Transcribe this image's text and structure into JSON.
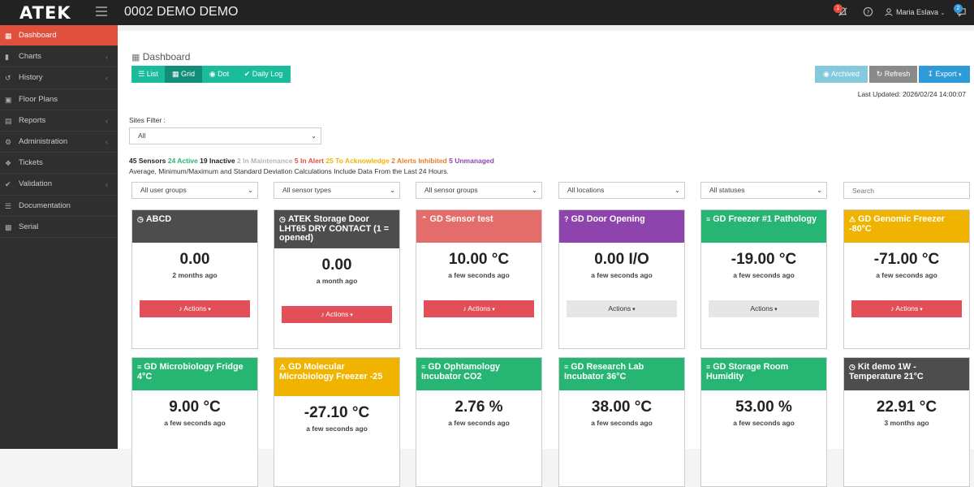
{
  "header": {
    "logo": "ATEK",
    "title": "0002 DEMO DEMO",
    "notif_count": "1",
    "user_name": "Maria Eslava",
    "user_badge": "2"
  },
  "sidebar": {
    "items": [
      {
        "label": "Dashboard",
        "icon": "dashboard-icon",
        "active": true
      },
      {
        "label": "Charts",
        "icon": "chart-icon",
        "expandable": true
      },
      {
        "label": "History",
        "icon": "history-icon",
        "expandable": true
      },
      {
        "label": "Floor Plans",
        "icon": "floorplan-icon"
      },
      {
        "label": "Reports",
        "icon": "reports-icon",
        "expandable": true
      },
      {
        "label": "Administration",
        "icon": "admin-icon",
        "expandable": true
      },
      {
        "label": "Tickets",
        "icon": "tag-icon"
      },
      {
        "label": "Validation",
        "icon": "check-circle-icon",
        "expandable": true
      },
      {
        "label": "Documentation",
        "icon": "book-icon"
      },
      {
        "label": "Serial",
        "icon": "serial-icon"
      }
    ]
  },
  "main": {
    "title": "Dashboard",
    "view_buttons": {
      "list": "List",
      "grid": "Grid",
      "dot": "Dot",
      "daily_log": "Daily Log"
    },
    "archived": "Archived",
    "refresh": "Refresh",
    "export": "Export",
    "last_updated": "Last Updated: 2026/02/24 14:00:07",
    "sites_filter_label": "Sites Filter :",
    "sites_filter_value": "All",
    "stats": {
      "sensors": "45 Sensors",
      "active": "24 Active",
      "inactive": "19 Inactive",
      "maintenance": "2 In Maintenance",
      "alert": "5 In Alert",
      "acknowledge": "25 To Acknowledge",
      "inhibited": "2 Alerts Inhibited",
      "unmanaged": "5 Unmanaged"
    },
    "note": "Average, Minimum/Maximum and Standard Deviation Calculations Include Data From the Last 24 Hours.",
    "filters": {
      "user_groups": "All user groups",
      "sensor_types": "All sensor types",
      "sensor_groups": "All sensor groups",
      "locations": "All locations",
      "statuses": "All statuses",
      "search_placeholder": "Search"
    },
    "actions_label": "Actions",
    "cards": [
      {
        "title": "ABCD",
        "icon": "clock-icon",
        "value": "0.00",
        "time": "2 months ago",
        "color": "#4d4d4d",
        "action_color": "#e34f58"
      },
      {
        "title": "ATEK Storage Door LHT65 DRY CONTACT (1 = opened)",
        "icon": "clock-icon",
        "value": "0.00",
        "time": "a month ago",
        "color": "#4d4d4d",
        "action_color": "#e34f58"
      },
      {
        "title": "GD Sensor test",
        "icon": "chevron-up-icon",
        "value": "10.00 °C",
        "time": "a few seconds ago",
        "color": "#e46c6b",
        "action_color": "#e34f58"
      },
      {
        "title": "GD Door Opening",
        "icon": "question-icon",
        "value": "0.00 I/O",
        "time": "a few seconds ago",
        "color": "#8e44ad",
        "action_color": "#e6e6e6"
      },
      {
        "title": "GD Freezer #1 Pathology",
        "icon": "signal-icon",
        "value": "-19.00 °C",
        "time": "a few seconds ago",
        "color": "#26b573",
        "action_color": "#e6e6e6"
      },
      {
        "title": "GD Genomic Freezer -80°C",
        "icon": "warning-icon",
        "value": "-71.00 °C",
        "time": "a few seconds ago",
        "color": "#f0b400",
        "action_color": "#e34f58"
      },
      {
        "title": "GD Microbiology Fridge 4°C",
        "icon": "signal-icon",
        "value": "9.00 °C",
        "time": "a few seconds ago",
        "color": "#26b573"
      },
      {
        "title": "GD Molecular Microbiology Freezer -25",
        "icon": "warning-icon",
        "value": "-27.10 °C",
        "time": "a few seconds ago",
        "color": "#f0b400"
      },
      {
        "title": "GD Ophtamology Incubator CO2",
        "icon": "signal-icon",
        "value": "2.76 %",
        "time": "a few seconds ago",
        "color": "#26b573"
      },
      {
        "title": "GD Research Lab Incubator 36°C",
        "icon": "signal-icon",
        "value": "38.00 °C",
        "time": "a few seconds ago",
        "color": "#26b573"
      },
      {
        "title": "GD Storage Room Humidity",
        "icon": "signal-icon",
        "value": "53.00 %",
        "time": "a few seconds ago",
        "color": "#26b573"
      },
      {
        "title": "Kit demo 1W - Temperature 21°C",
        "icon": "clock-icon",
        "value": "22.91 °C",
        "time": "3 months ago",
        "color": "#4d4d4d"
      }
    ]
  }
}
